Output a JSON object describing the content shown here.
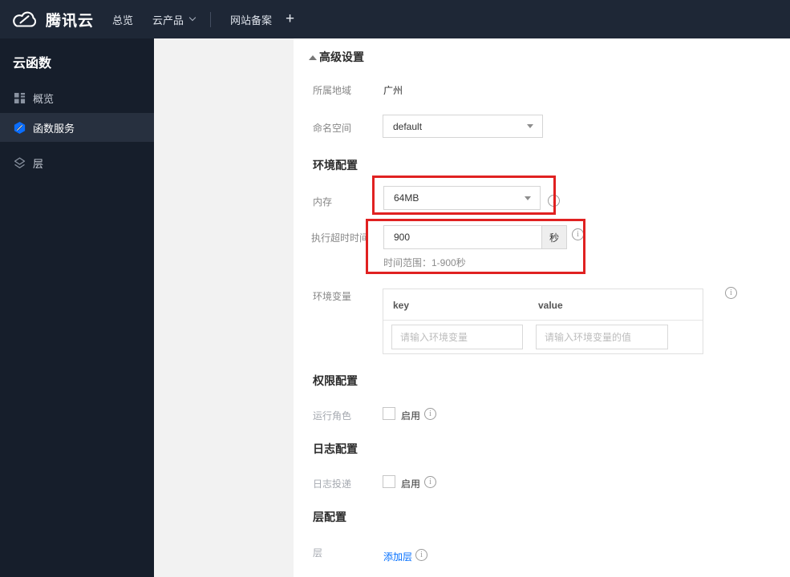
{
  "topbar": {
    "brand": "腾讯云",
    "nav_overview": "总览",
    "nav_products": "云产品",
    "nav_icp": "网站备案",
    "nav_plus": "+"
  },
  "sidebar": {
    "title": "云函数",
    "items": [
      {
        "label": "概览",
        "icon": "grid-icon",
        "selected": false
      },
      {
        "label": "函数服务",
        "icon": "scf-hexagon-icon",
        "selected": true
      },
      {
        "label": "层",
        "icon": "layers-icon",
        "selected": false
      }
    ]
  },
  "content": {
    "advanced_settings": "高级设置",
    "region_label": "所属地域",
    "region_value": "广州",
    "namespace_label": "命名空间",
    "namespace_value": "default",
    "section_env": "环境配置",
    "memory_label": "内存",
    "memory_value": "64MB",
    "timeout_label": "执行超时时间",
    "timeout_value": "900",
    "timeout_unit": "秒",
    "timeout_hint": "时间范围：1-900秒",
    "envvar_label": "环境变量",
    "envvar_col_key": "key",
    "envvar_col_value": "value",
    "envvar_key_placeholder": "请输入环境变量",
    "envvar_value_placeholder": "请输入环境变量的值",
    "section_perm": "权限配置",
    "runrole_label": "运行角色",
    "enable_label": "启用",
    "section_log": "日志配置",
    "logship_label": "日志投递",
    "section_layer": "层配置",
    "layer_label": "层",
    "add_layer_link": "添加层"
  },
  "colors": {
    "accent_blue": "#006eff",
    "annotation_red": "#e02121",
    "navbar_bg": "#1e2736",
    "sidebar_bg": "#161e2b",
    "sidebar_selected_bg": "#27303f",
    "panel_gray": "#f2f2f2"
  }
}
